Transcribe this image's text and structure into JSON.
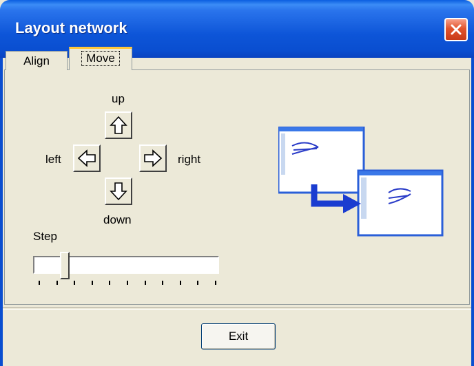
{
  "window": {
    "title": "Layout network"
  },
  "tabs": [
    {
      "label": "Align"
    },
    {
      "label": "Move",
      "selected": true
    }
  ],
  "move": {
    "up_label": "up",
    "down_label": "down",
    "left_label": "left",
    "right_label": "right",
    "step_label": "Step",
    "step_slider": {
      "value_fraction": 0.15,
      "tick_count": 11
    }
  },
  "footer": {
    "exit_label": "Exit"
  },
  "icons": {
    "close": "close-icon",
    "up": "arrow-up-icon",
    "down": "arrow-down-icon",
    "left": "arrow-left-icon",
    "right": "arrow-right-icon",
    "illustration": "move-network-illustration"
  },
  "colors": {
    "titlebar": "#0a4ed0",
    "close": "#e2542d",
    "face": "#ece9d8",
    "tab_hot": "#ffc83c"
  }
}
